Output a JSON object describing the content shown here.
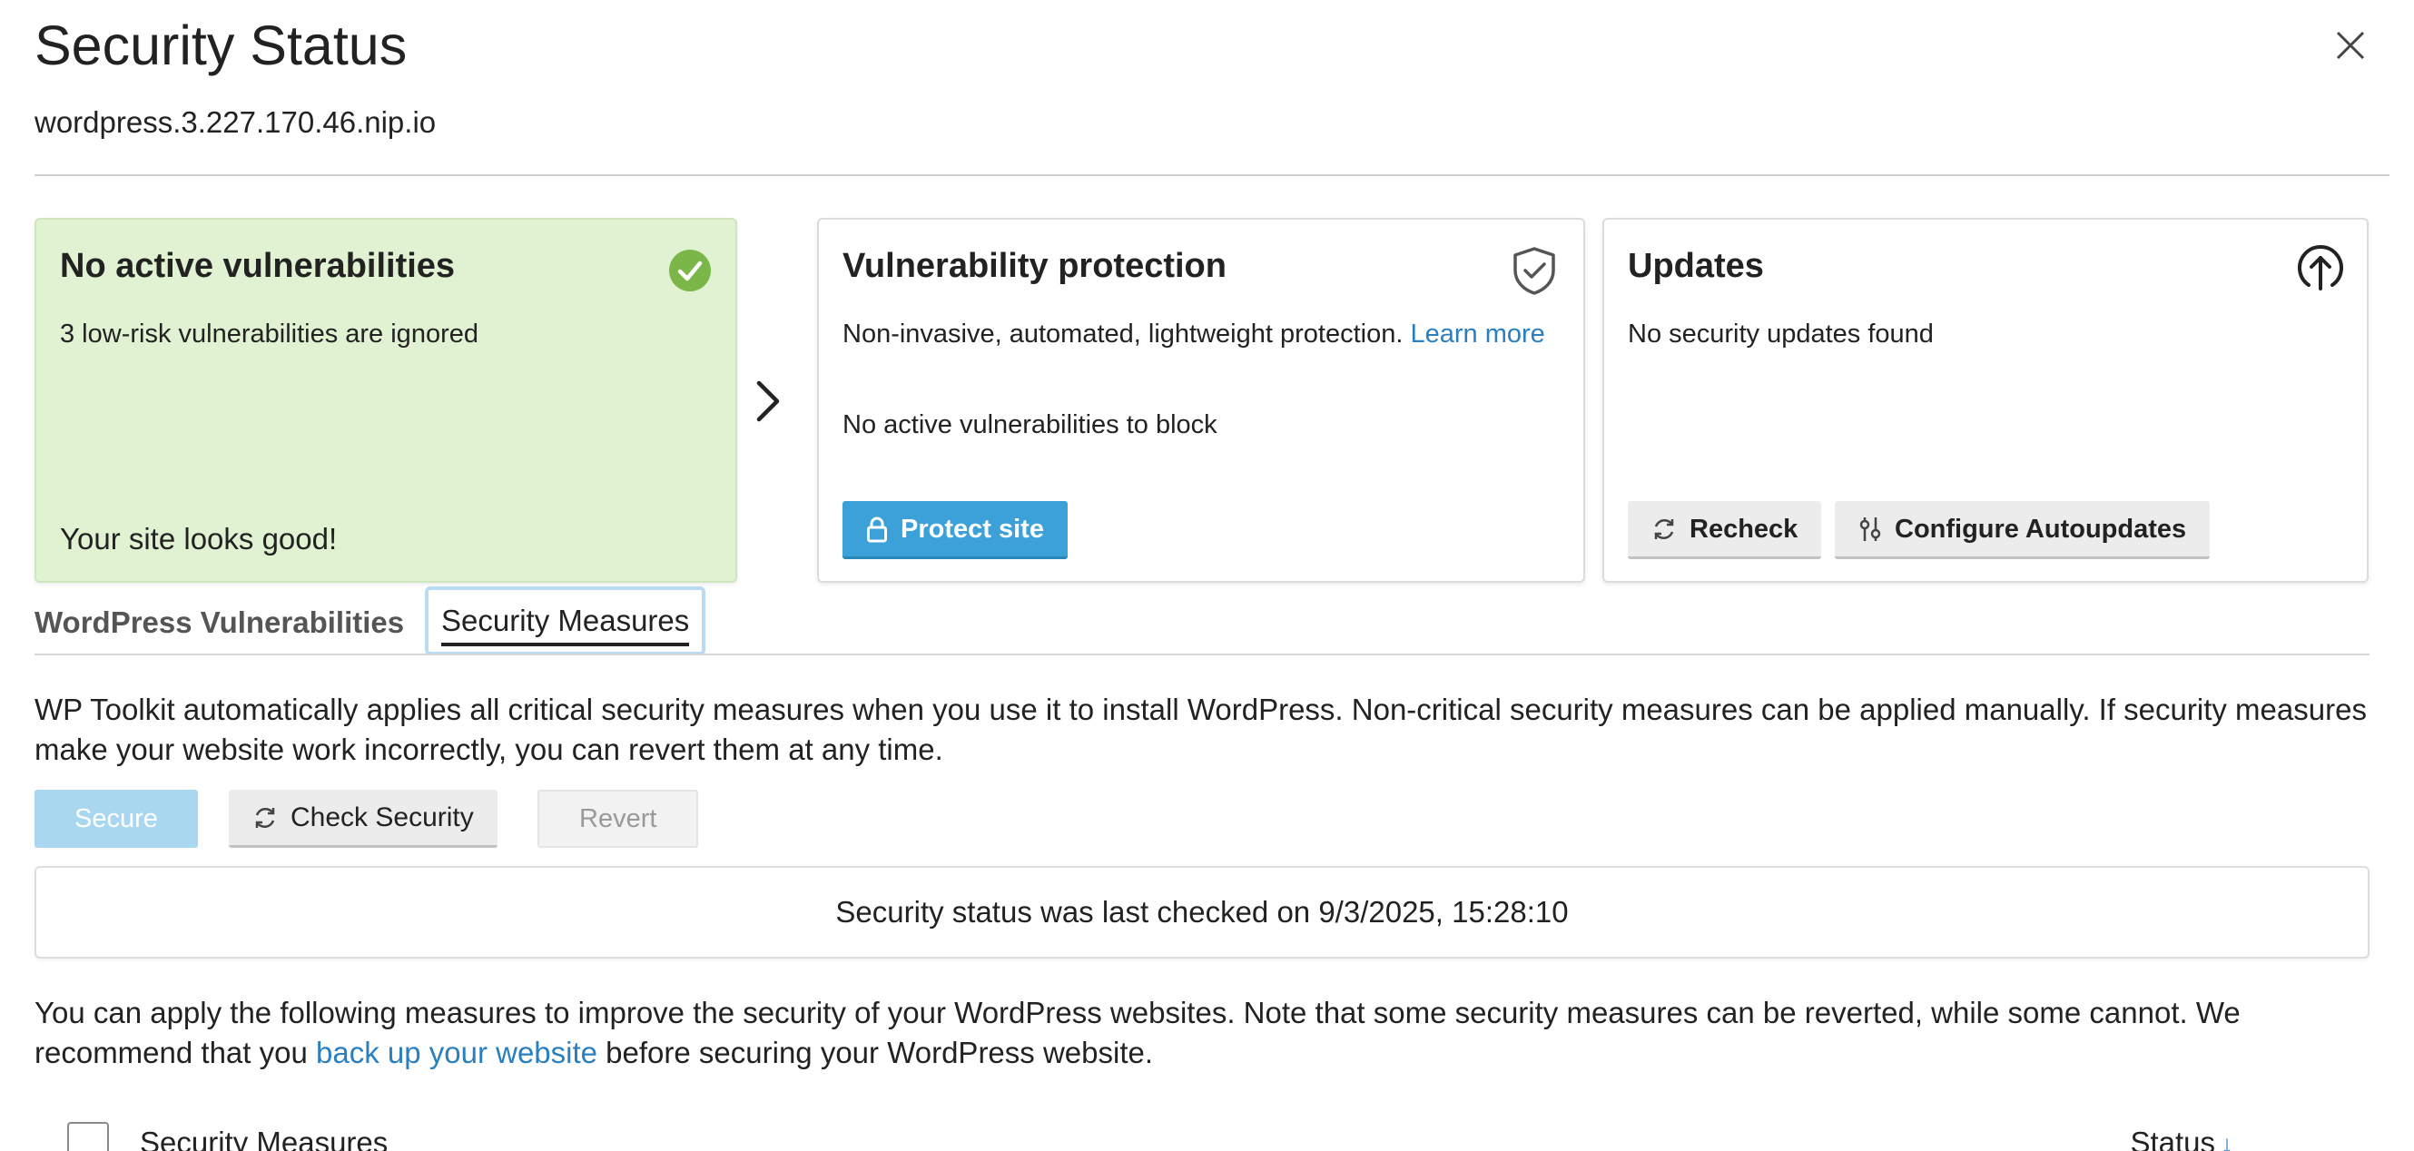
{
  "dialog": {
    "title": "Security Status",
    "subtitle": "wordpress.3.227.170.46.nip.io"
  },
  "cards": {
    "vulnerabilities": {
      "title": "No active vulnerabilities",
      "text": "3 low-risk vulnerabilities are ignored",
      "footer": "Your site looks good!",
      "icon": "check-circle-icon",
      "bg_color": "#e1f2d3"
    },
    "protection": {
      "title": "Vulnerability protection",
      "text": "Non-invasive, automated, lightweight protection.",
      "learn_more": "Learn more",
      "status": "No active vulnerabilities to block",
      "button": "Protect site",
      "icon": "shield-check-icon"
    },
    "updates": {
      "title": "Updates",
      "text": "No security updates found",
      "recheck_button": "Recheck",
      "configure_button": "Configure Autoupdates",
      "icon": "upload-circle-icon"
    }
  },
  "tabs": [
    {
      "label": "WordPress Vulnerabilities",
      "active": false
    },
    {
      "label": "Security Measures",
      "active": true
    }
  ],
  "measures": {
    "intro": "WP Toolkit automatically applies all critical security measures when you use it to install WordPress. Non-critical security measures can be applied manually. If security measures make your website work incorrectly, you can revert them at any time.",
    "secure_button": "Secure",
    "check_button": "Check Security",
    "revert_button": "Revert",
    "last_checked": "Security status was last checked on 9/3/2025, 15:28:10",
    "apply_text_before": "You can apply the following measures to improve the security of your WordPress websites. Note that some security measures can be reverted, while some cannot. We recommend that you ",
    "backup_link": "back up your website",
    "apply_text_after": " before securing your WordPress website.",
    "table": {
      "col_name": "Security Measures",
      "col_status": "Status"
    }
  },
  "colors": {
    "accent": "#3ba1d8",
    "link": "#2a7fc0",
    "success": "#7ab648"
  }
}
